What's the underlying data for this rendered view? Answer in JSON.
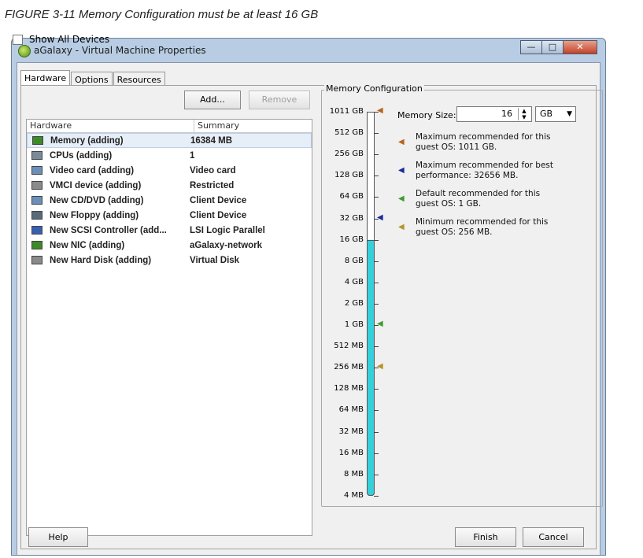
{
  "caption": "FIGURE 3-11 Memory Configuration must be at least 16 GB",
  "window": {
    "title": "aGalaxy - Virtual Machine Properties",
    "controls": [
      "minimize-icon",
      "maximize-icon",
      "close-icon"
    ]
  },
  "tabs": [
    {
      "label": "Hardware",
      "active": true
    },
    {
      "label": "Options",
      "active": false
    },
    {
      "label": "Resources",
      "active": false
    }
  ],
  "hardware_panel": {
    "show_all_label": "Show All Devices",
    "add_label": "Add...",
    "remove_label": "Remove",
    "col_hardware": "Hardware",
    "col_summary": "Summary",
    "rows": [
      {
        "name": "Memory (adding)",
        "summary": "16384 MB",
        "icon": "memory-icon",
        "selected": true
      },
      {
        "name": "CPUs (adding)",
        "summary": "1",
        "icon": "cpu-icon"
      },
      {
        "name": "Video card  (adding)",
        "summary": "Video card",
        "icon": "video-card-icon"
      },
      {
        "name": "VMCI device (adding)",
        "summary": "Restricted",
        "icon": "vmci-icon"
      },
      {
        "name": "New CD/DVD (adding)",
        "summary": "Client Device",
        "icon": "cd-dvd-icon"
      },
      {
        "name": "New Floppy (adding)",
        "summary": "Client Device",
        "icon": "floppy-icon"
      },
      {
        "name": "New SCSI Controller (add...",
        "summary": "LSI Logic Parallel",
        "icon": "scsi-icon"
      },
      {
        "name": "New NIC (adding)",
        "summary": "aGalaxy-network",
        "icon": "nic-icon"
      },
      {
        "name": "New Hard Disk (adding)",
        "summary": "Virtual Disk",
        "icon": "hard-disk-icon"
      }
    ]
  },
  "memory_config": {
    "title": "Memory Configuration",
    "size_label": "Memory Size:",
    "size_value": "16",
    "unit": "GB",
    "scale_labels": [
      "1011 GB",
      "512 GB",
      "256 GB",
      "128 GB",
      "64 GB",
      "32 GB",
      "16 GB",
      "8 GB",
      "4 GB",
      "2 GB",
      "1 GB",
      "512 MB",
      "256 MB",
      "128 MB",
      "64 MB",
      "32 MB",
      "16 MB",
      "8 MB",
      "4 MB"
    ],
    "selected_level": "16 GB",
    "legend": [
      {
        "text": "Maximum recommended for this guest OS: 1011 GB.",
        "color": "#b5651d"
      },
      {
        "text": "Maximum recommended for best performance: 32656 MB.",
        "color": "#1c2a9c"
      },
      {
        "text": "Default recommended for this guest OS: 1 GB.",
        "color": "#3f9b2e"
      },
      {
        "text": "Minimum recommended for this guest OS: 256 MB.",
        "color": "#b8922a"
      }
    ],
    "bar_color": "#35d0dc"
  },
  "footer": {
    "help_label": "Help",
    "finish_label": "Finish",
    "cancel_label": "Cancel"
  }
}
